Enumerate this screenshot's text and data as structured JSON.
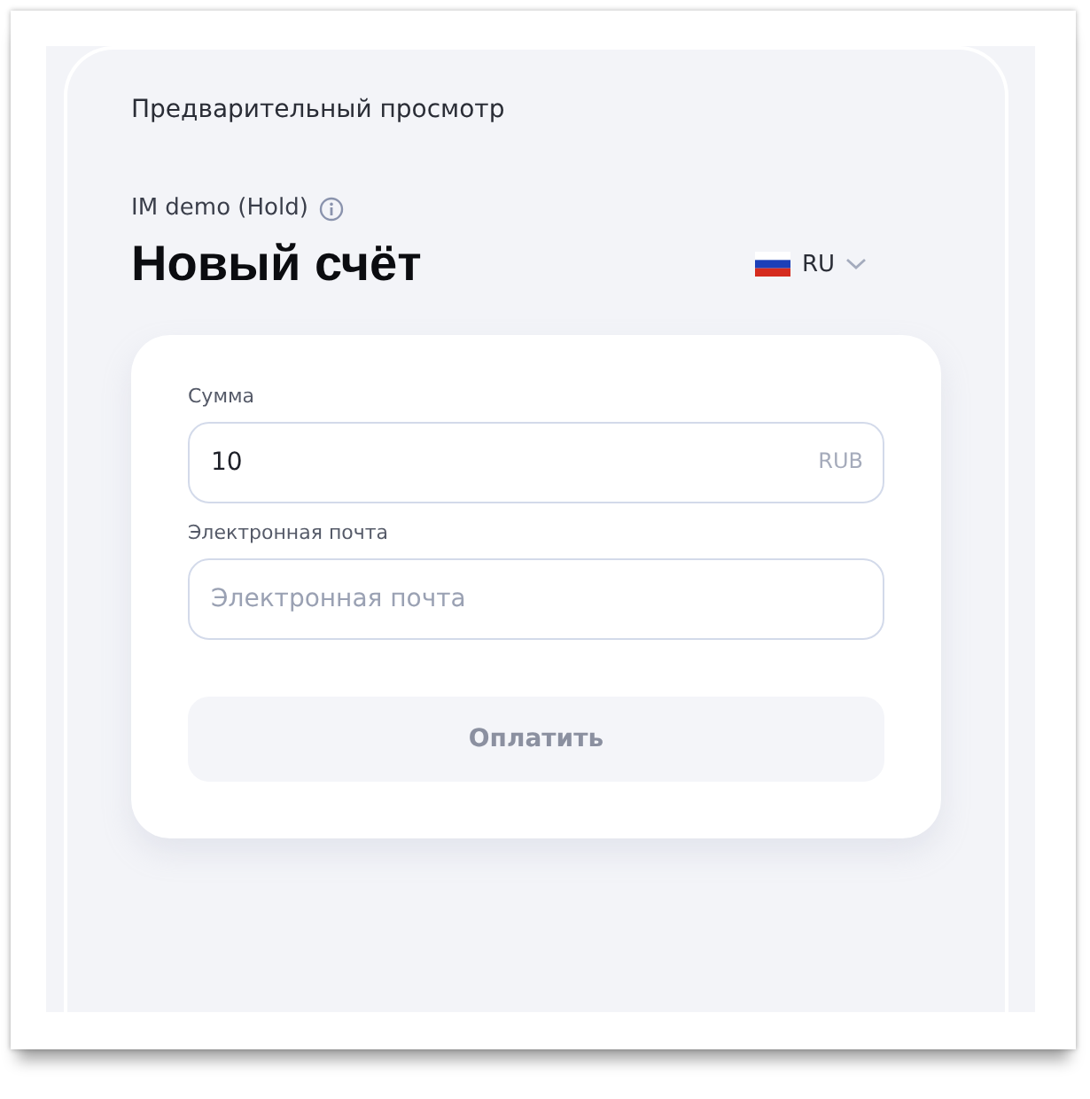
{
  "preview_title": "Предварительный просмотр",
  "merchant": {
    "name": "IM demo (Hold)"
  },
  "heading": "Новый счёт",
  "language": {
    "code": "RU"
  },
  "form": {
    "fields": [
      {
        "label": "Сумма",
        "value": "10",
        "suffix": "RUB"
      },
      {
        "label": "Электронная почта",
        "placeholder": "Электронная почта"
      }
    ],
    "submit": {
      "label": "Оплатить",
      "disabled": true
    }
  }
}
